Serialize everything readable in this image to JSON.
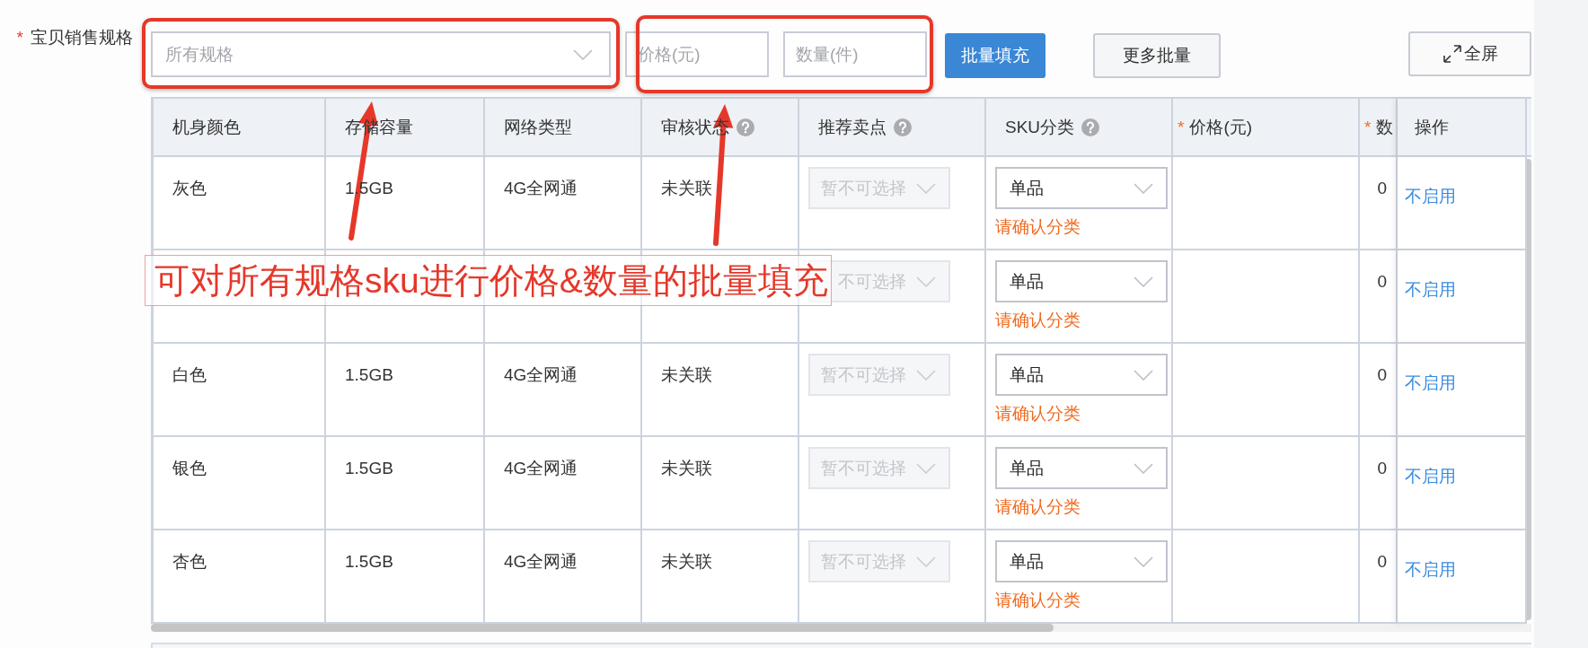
{
  "form": {
    "required_mark": "*",
    "label": "宝贝销售规格"
  },
  "batch": {
    "spec_select": {
      "placeholder": "所有规格"
    },
    "price_field": {
      "placeholder": "价格(元)"
    },
    "quantity_field": {
      "placeholder": "数量(件)"
    },
    "buttons": [
      {
        "label": "批量填充",
        "kind": "primary"
      },
      {
        "label": "更多批量",
        "kind": "default"
      }
    ]
  },
  "fullscreen_button": {
    "label": "全屏"
  },
  "table": {
    "columns": [
      {
        "label": "机身颜色",
        "help": false
      },
      {
        "label": "存储容量",
        "help": false
      },
      {
        "label": "网络类型",
        "help": false
      },
      {
        "label": "审核状态",
        "help": true
      },
      {
        "label": "推荐卖点",
        "help": true
      },
      {
        "label": "SKU分类",
        "help": true
      },
      {
        "required_mark": "*",
        "label": "价格(元)",
        "help": false
      },
      {
        "required_mark": "*",
        "label": "数",
        "help": false
      },
      {
        "label": "操作",
        "help": false
      }
    ],
    "rows": [
      {
        "cells": [
          "灰色",
          "1.5GB",
          "4G全网通",
          "未关联"
        ],
        "selling_point": {
          "placeholder": "暂不可选择",
          "disabled": true
        },
        "sku_category": {
          "value": "单品",
          "disabled": false,
          "hint": "请确认分类"
        },
        "quantity": "0",
        "action": "不启用"
      },
      {
        "selling_point": {
          "placeholder": "不可选择",
          "disabled": true
        },
        "sku_category": {
          "value": "单品",
          "disabled": false,
          "hint": "请确认分类"
        },
        "quantity": "0",
        "action": "不启用"
      },
      {
        "cells": [
          "白色",
          "1.5GB",
          "4G全网通",
          "未关联"
        ],
        "selling_point": {
          "placeholder": "暂不可选择",
          "disabled": true
        },
        "sku_category": {
          "value": "单品",
          "disabled": false,
          "hint": "请确认分类"
        },
        "quantity": "0",
        "action": "不启用"
      },
      {
        "cells": [
          "银色",
          "1.5GB",
          "4G全网通",
          "未关联"
        ],
        "selling_point": {
          "placeholder": "暂不可选择",
          "disabled": true
        },
        "sku_category": {
          "value": "单品",
          "disabled": false,
          "hint": "请确认分类"
        },
        "quantity": "0",
        "action": "不启用"
      },
      {
        "cells": [
          "杏色",
          "1.5GB",
          "4G全网通",
          "未关联"
        ],
        "selling_point": {
          "placeholder": "暂不可选择",
          "disabled": true
        },
        "sku_category": {
          "value": "单品",
          "disabled": false,
          "hint": "请确认分类"
        },
        "quantity": "0",
        "action": "不启用"
      }
    ]
  },
  "annotation": {
    "text": "可对所有规格sku进行价格&数量的批量填充"
  }
}
